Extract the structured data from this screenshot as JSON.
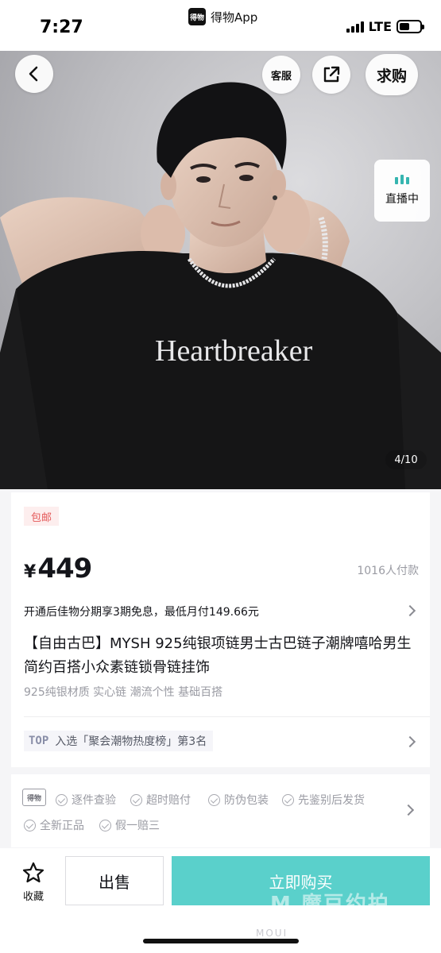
{
  "status_bar": {
    "time": "7:27",
    "app_name": "得物App",
    "app_logo_text": "得物",
    "network": "LTE",
    "battery_level": 0.48
  },
  "hero": {
    "shirt_text": "Heartbreaker",
    "image_index": "4/10",
    "buttons": {
      "back_icon": "chevron-left-icon",
      "service_label": "客服",
      "share_icon": "share-icon",
      "wanted_label": "求购"
    },
    "live": {
      "label": "直播中",
      "accent": "#36b5b0"
    }
  },
  "product": {
    "shipping_tag": "包邮",
    "price_symbol": "¥",
    "price": "449",
    "sold_count": "1016人付款",
    "installment": "开通后佳物分期享3期免息，最低月付149.66元",
    "title": "【自由古巴】MYSH 925纯银项链男士古巴链子潮牌嘻哈男生简约百搭小众素链锁骨链挂饰",
    "features": "925纯银材质 实心链 潮流个性 基础百搭",
    "rank": {
      "badge": "TOP",
      "text": "入选「聚会潮物热度榜」第3名"
    }
  },
  "guarantee": {
    "logo_text": "得物",
    "items": [
      "逐件查验",
      "超时赔付",
      "防伪包装",
      "先鉴别后发货",
      "全新正品",
      "假一赔三"
    ]
  },
  "bottom_bar": {
    "favorite_label": "收藏",
    "sell_label": "出售",
    "buy_label": "立即购买",
    "buy_color": "#5ad0cb",
    "watermark": "M 魔豆约拍",
    "watermark_faint": "MOUI"
  }
}
